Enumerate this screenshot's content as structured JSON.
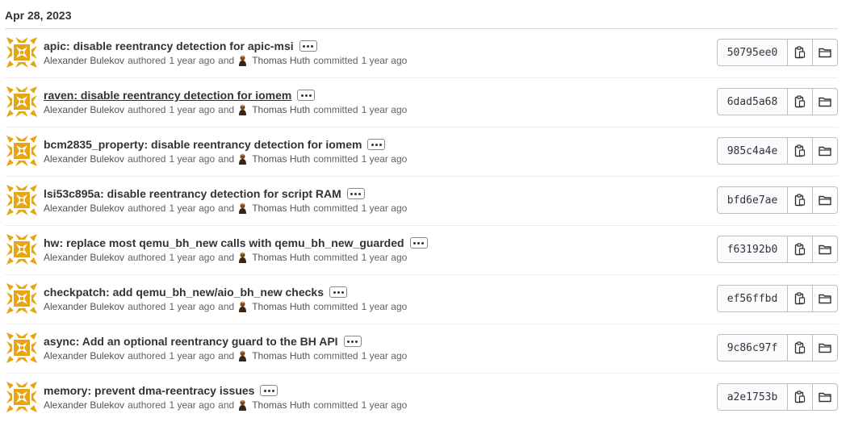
{
  "date_header": "Apr 28, 2023",
  "commits": [
    {
      "title": "apic: disable reentrancy detection for apic-msi",
      "author": "Alexander Bulekov",
      "authored_label": "authored",
      "authored_time": "1 year ago",
      "and_label": "and",
      "committer": "Thomas Huth",
      "committed_label": "committed",
      "committed_time": "1 year ago",
      "sha": "50795ee0"
    },
    {
      "title": "raven: disable reentrancy detection for iomem",
      "author": "Alexander Bulekov",
      "authored_label": "authored",
      "authored_time": "1 year ago",
      "and_label": "and",
      "committer": "Thomas Huth",
      "committed_label": "committed",
      "committed_time": "1 year ago",
      "sha": "6dad5a68"
    },
    {
      "title": "bcm2835_property: disable reentrancy detection for iomem",
      "author": "Alexander Bulekov",
      "authored_label": "authored",
      "authored_time": "1 year ago",
      "and_label": "and",
      "committer": "Thomas Huth",
      "committed_label": "committed",
      "committed_time": "1 year ago",
      "sha": "985c4a4e"
    },
    {
      "title": "lsi53c895a: disable reentrancy detection for script RAM",
      "author": "Alexander Bulekov",
      "authored_label": "authored",
      "authored_time": "1 year ago",
      "and_label": "and",
      "committer": "Thomas Huth",
      "committed_label": "committed",
      "committed_time": "1 year ago",
      "sha": "bfd6e7ae"
    },
    {
      "title": "hw: replace most qemu_bh_new calls with qemu_bh_new_guarded",
      "author": "Alexander Bulekov",
      "authored_label": "authored",
      "authored_time": "1 year ago",
      "and_label": "and",
      "committer": "Thomas Huth",
      "committed_label": "committed",
      "committed_time": "1 year ago",
      "sha": "f63192b0"
    },
    {
      "title": "checkpatch: add qemu_bh_new/aio_bh_new checks",
      "author": "Alexander Bulekov",
      "authored_label": "authored",
      "authored_time": "1 year ago",
      "and_label": "and",
      "committer": "Thomas Huth",
      "committed_label": "committed",
      "committed_time": "1 year ago",
      "sha": "ef56ffbd"
    },
    {
      "title": "async: Add an optional reentrancy guard to the BH API",
      "author": "Alexander Bulekov",
      "authored_label": "authored",
      "authored_time": "1 year ago",
      "and_label": "and",
      "committer": "Thomas Huth",
      "committed_label": "committed",
      "committed_time": "1 year ago",
      "sha": "9c86c97f"
    },
    {
      "title": "memory: prevent dma-reentracy issues",
      "author": "Alexander Bulekov",
      "authored_label": "authored",
      "authored_time": "1 year ago",
      "and_label": "and",
      "committer": "Thomas Huth",
      "committed_label": "committed",
      "committed_time": "1 year ago",
      "sha": "a2e1753b"
    }
  ],
  "icons": {
    "avatar": "identicon-avatar",
    "committer_avatar": "user-avatar-icon",
    "more": "ellipsis-icon",
    "copy": "copy-to-clipboard-icon",
    "browse": "folder-icon"
  },
  "colors": {
    "identicon": "#e8a512",
    "text": "#333238",
    "muted": "#626168",
    "border": "#bfbfc3"
  }
}
